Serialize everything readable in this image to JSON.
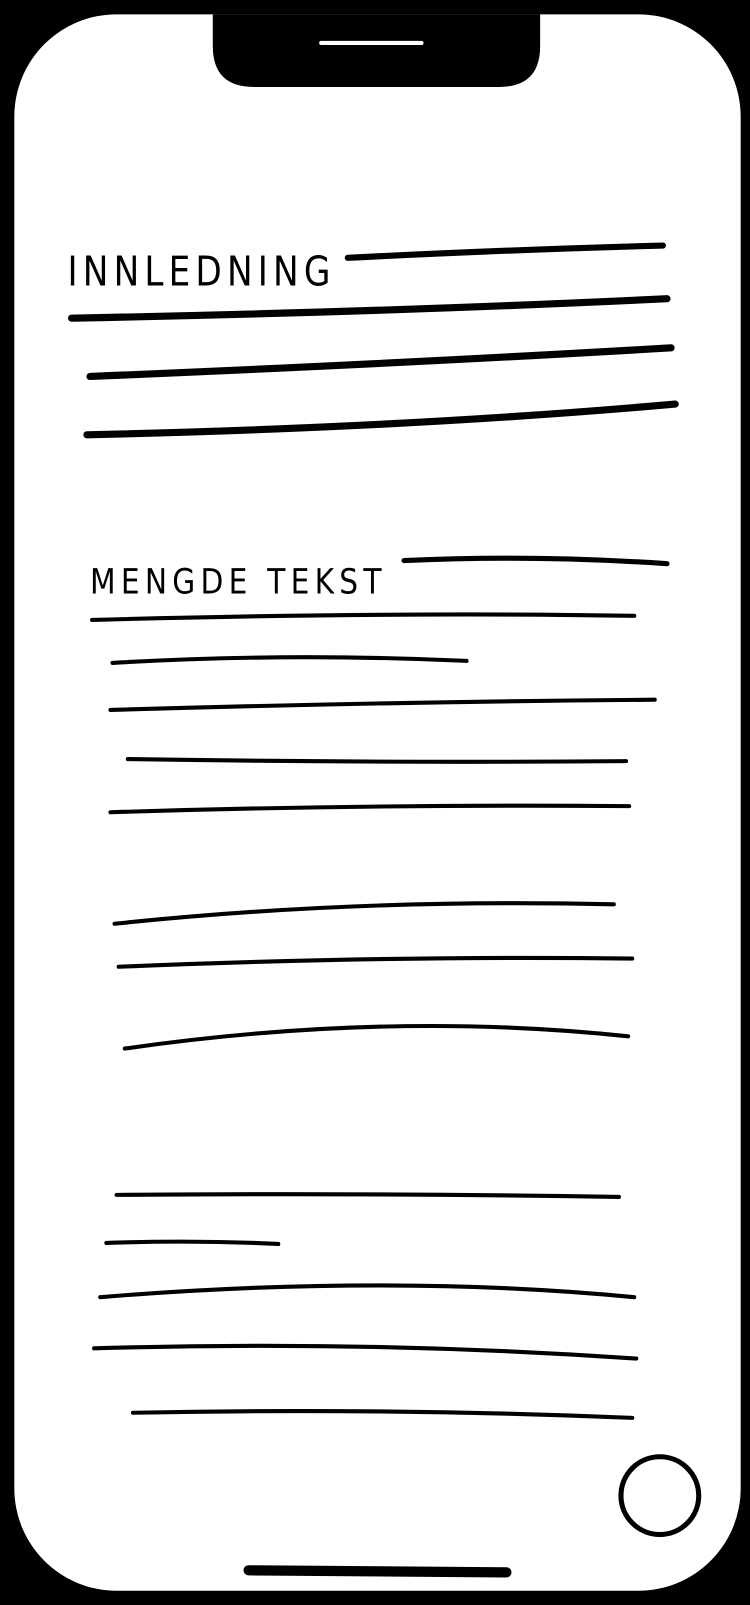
{
  "screen": {
    "heading_intro": "INNLEDNING",
    "heading_body": "MENGDE TEKST"
  },
  "colors": {
    "frame": "#000000",
    "screen": "#ffffff",
    "ink": "#000000"
  },
  "icons": {
    "notch_speaker": "speaker-icon",
    "floating_button": "circle-button-icon",
    "home_indicator": "home-bar-icon"
  }
}
